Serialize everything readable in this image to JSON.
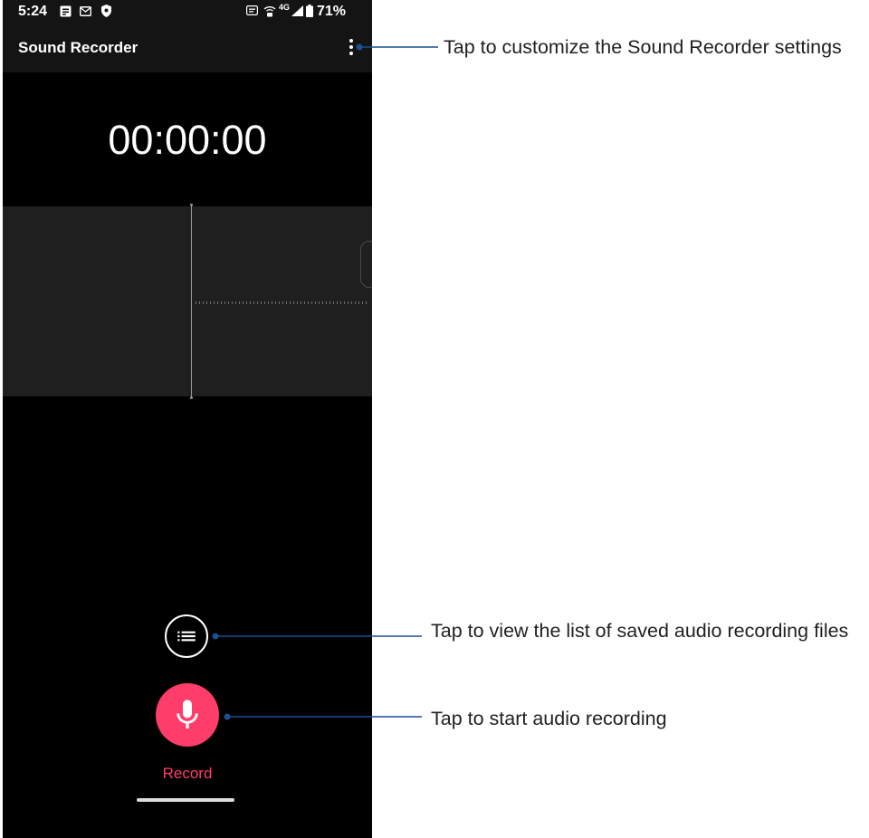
{
  "status_bar": {
    "time": "5:24",
    "network_type": "4G",
    "battery_percent": "71%",
    "icons_left": [
      "news-notification-icon",
      "mail-icon",
      "shield-icon"
    ],
    "icons_right": [
      "volte-icon",
      "wifi-calling-icon",
      "signal-icon",
      "battery-icon"
    ]
  },
  "app_bar": {
    "title": "Sound Recorder",
    "menu_icon": "more-vert-icon"
  },
  "recorder": {
    "timer": "00:00:00"
  },
  "controls": {
    "list_button_icon": "list-icon",
    "record_button_icon": "mic-icon",
    "record_label": "Record"
  },
  "annotations": {
    "settings": "Tap to customize the Sound Recorder settings",
    "recordings_list": "Tap to view the list of saved audio recording files",
    "start_recording": "Tap to start audio recording"
  },
  "colors": {
    "screen_background": "#000000",
    "waveform_panel": "#1f1f1f",
    "accent": "#ff3d6a",
    "callout_line": "#1c4f8f",
    "annotation_text": "#231f20"
  }
}
